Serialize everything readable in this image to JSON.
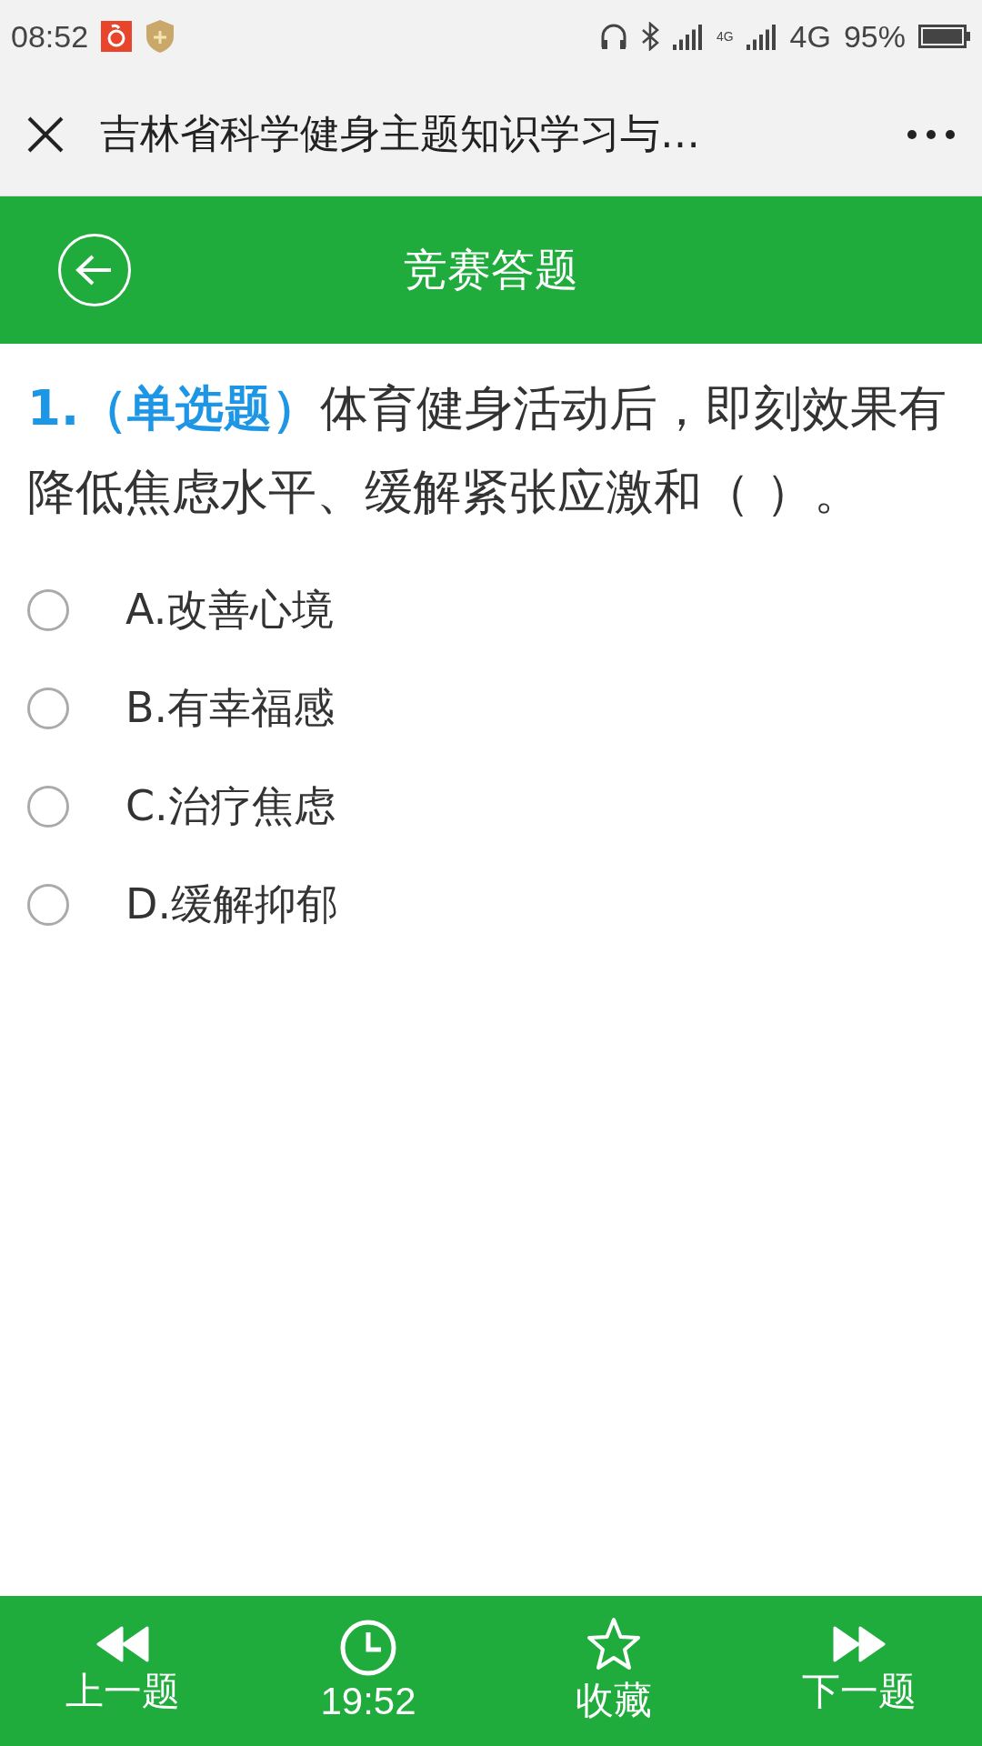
{
  "status_bar": {
    "time": "08:52",
    "network_small": "4G",
    "network": "4G",
    "battery": "95%"
  },
  "title_bar": {
    "title": "吉林省科学健身主题知识学习与…"
  },
  "header": {
    "title": "竞赛答题"
  },
  "question": {
    "prefix": "1.（单选题）",
    "text": "体育健身活动后，即刻效果有降低焦虑水平、缓解紧张应激和（ ）。"
  },
  "options": [
    {
      "label": "A.改善心境",
      "selected": false
    },
    {
      "label": "B.有幸福感",
      "selected": false
    },
    {
      "label": "C.治疗焦虑",
      "selected": false
    },
    {
      "label": "D.缓解抑郁",
      "selected": false
    }
  ],
  "bottom_bar": [
    {
      "kind": "prev",
      "label": "上一题"
    },
    {
      "kind": "timer",
      "label": "19:52"
    },
    {
      "kind": "favorite",
      "label": "收藏"
    },
    {
      "kind": "next",
      "label": "下一题"
    }
  ]
}
